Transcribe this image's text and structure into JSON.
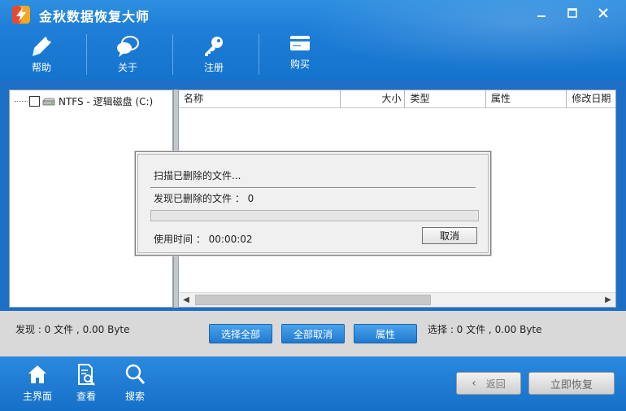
{
  "app": {
    "title": "金秋数据恢复大师"
  },
  "toolbar": {
    "items": [
      {
        "label": "帮助",
        "icon": "pen-icon"
      },
      {
        "label": "关于",
        "icon": "chat-bubble-icon"
      },
      {
        "label": "注册",
        "icon": "key-icon"
      },
      {
        "label": "购买",
        "icon": "card-icon"
      }
    ]
  },
  "tree": {
    "items": [
      {
        "label": "NTFS - 逻辑磁盘 (C:)",
        "checked": false
      }
    ]
  },
  "file_list": {
    "columns": [
      "名称",
      "大小",
      "类型",
      "属性",
      "修改日期"
    ],
    "rows": []
  },
  "status": {
    "found_text": "发现 : 0 文件 , 0.00 Byte",
    "selected_text": "选择 : 0 文件 , 0.00 Byte",
    "select_all_label": "选择全部",
    "deselect_all_label": "全部取消",
    "properties_label": "属性"
  },
  "dialog": {
    "scanning_text": "扫描已删除的文件...",
    "found_text": "发现已删除的文件 ： 0",
    "progress_fraction": 0,
    "elapsed_text": "使用时间 ： 00:00:02",
    "cancel_label": "取消"
  },
  "bottom_nav": {
    "items": [
      {
        "label": "主界面",
        "icon": "home-icon"
      },
      {
        "label": "查看",
        "icon": "document-search-icon"
      },
      {
        "label": "搜索",
        "icon": "search-icon"
      }
    ],
    "back_label": "返回",
    "recover_label": "立即恢复"
  },
  "colors": {
    "accent": "#1f7fd8",
    "button": "#2a85d8"
  }
}
